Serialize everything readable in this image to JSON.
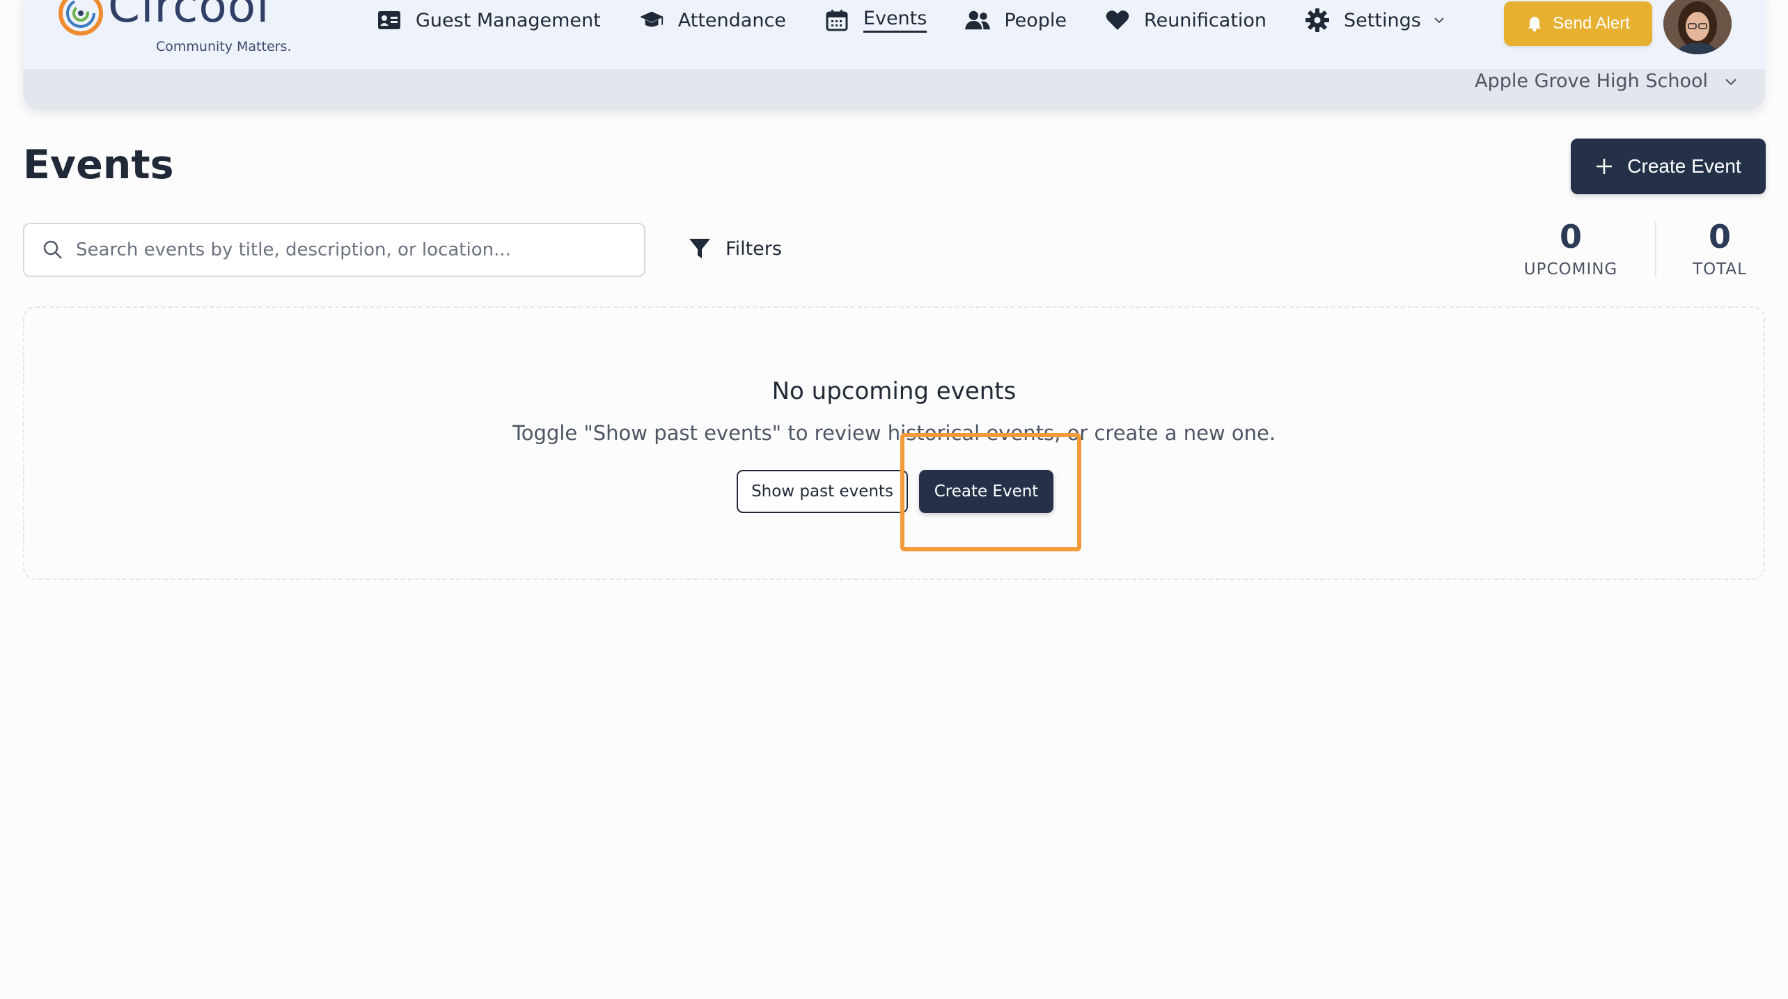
{
  "app": {
    "logo_text": "Circool",
    "tagline": "Community Matters."
  },
  "nav": {
    "items": [
      {
        "label": "Guest Management",
        "icon": "id-card-icon"
      },
      {
        "label": "Attendance",
        "icon": "graduation-cap-icon"
      },
      {
        "label": "Events",
        "icon": "calendar-icon",
        "active": true
      },
      {
        "label": "People",
        "icon": "users-icon"
      },
      {
        "label": "Reunification",
        "icon": "heart-icon"
      },
      {
        "label": "Settings",
        "icon": "gear-icon",
        "dropdown": true
      }
    ]
  },
  "header": {
    "send_alert_label": "Send Alert",
    "school_name": "Apple Grove High School"
  },
  "page": {
    "title": "Events",
    "create_event_label": "Create Event"
  },
  "search": {
    "value": "",
    "placeholder": "Search events by title, description, or location..."
  },
  "filters": {
    "label": "Filters"
  },
  "stats": {
    "upcoming": {
      "value": "0",
      "label": "UPCOMING"
    },
    "total": {
      "value": "0",
      "label": "TOTAL"
    }
  },
  "empty_state": {
    "title": "No upcoming events",
    "description": "Toggle \"Show past events\" to review historical events, or create a new one.",
    "show_past_label": "Show past events",
    "create_label": "Create Event"
  },
  "colors": {
    "accent_dark": "#253149",
    "alert": "#e8b031",
    "highlight": "#f39a3b"
  }
}
